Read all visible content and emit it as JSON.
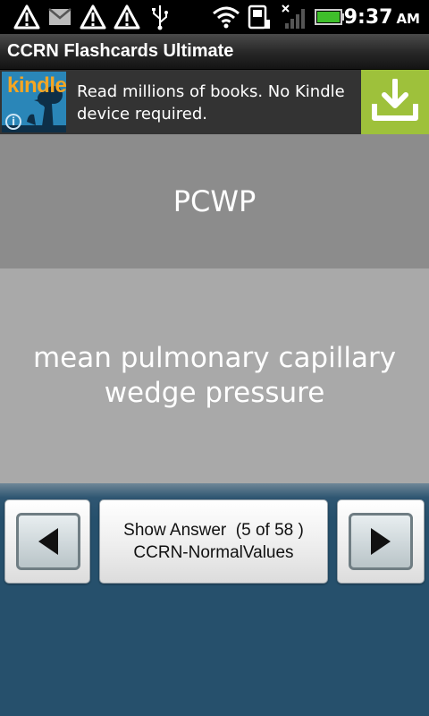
{
  "status_bar": {
    "time": "9:37",
    "ampm": "AM",
    "icons": [
      "warning-icon",
      "gmail-icon",
      "warning-icon",
      "warning-icon",
      "usb-icon",
      "wifi-icon",
      "phone-storage-icon",
      "signal-icon",
      "battery-icon"
    ]
  },
  "app": {
    "title": "CCRN Flashcards Ultimate"
  },
  "ad": {
    "brand": "kindle",
    "text": "Read millions of books. No Kindle device required.",
    "info_glyph": "i"
  },
  "card": {
    "term": "PCWP",
    "definition": "mean pulmonary capillary wedge pressure"
  },
  "nav": {
    "show_answer_label": "Show Answer  (5 of 58 )",
    "deck_name": "CCRN-NormalValues"
  },
  "colors": {
    "title_bar": "#262626",
    "ad_download": "#9ec13b",
    "card_front": "#8c8c8c",
    "card_back": "#a9a9a9",
    "nav_bg": "#26506c"
  }
}
